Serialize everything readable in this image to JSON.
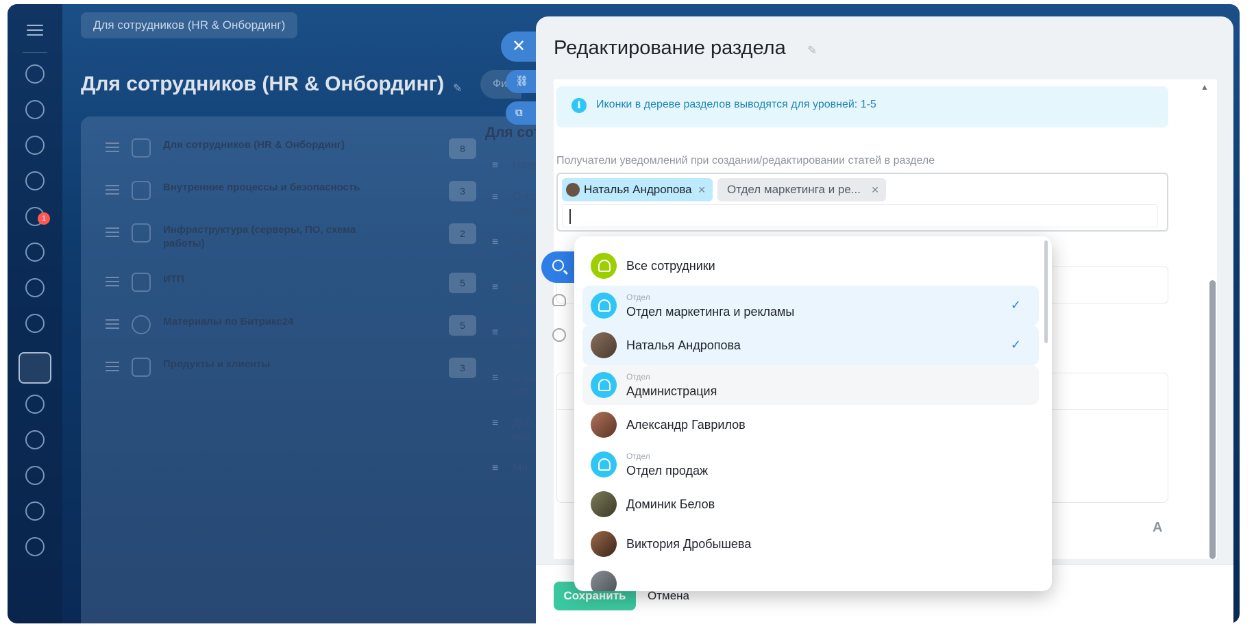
{
  "breadcrumb": "Для сотрудников (HR & Онбординг)",
  "page_title": "Для сотрудников (HR & Онбординг)",
  "filter_label": "Фи",
  "rail": {
    "badge": "1"
  },
  "tree": [
    {
      "label": "Для сотрудников (HR & Онбординг)",
      "count": "8"
    },
    {
      "label": "Внутренние процессы и безопасность",
      "count": "3"
    },
    {
      "label": "Инфраструктура (серверы, ПО, схема работы)",
      "count": "2"
    },
    {
      "label": "ИТП",
      "count": "5"
    },
    {
      "label": "Материалы по Битрикс24",
      "count": "5"
    },
    {
      "label": "Продукты и клиенты",
      "count": "3"
    }
  ],
  "column2": {
    "header": "Для сот",
    "items": [
      "Назв",
      "О ко цен",
      "Шаб спра",
      "Кор спор",
      "Как в си",
      "Стру кто",
      "Доб пер",
      "Мо"
    ]
  },
  "slider": {
    "title": "Редактирование раздела",
    "info": "Иконки в дереве разделов выводятся для уровней: 1-5",
    "recipients_label": "Получатели уведомлений при создании/редактировании статей в разделе",
    "tags": [
      {
        "label": "Наталья Андропова"
      },
      {
        "label": "Отдел маркетинга и ре..."
      }
    ],
    "ghost_letter": "A",
    "save": "Сохранить",
    "cancel": "Отмена"
  },
  "dropdown": {
    "items": [
      {
        "name": "Все сотрудники",
        "sub": "",
        "kind": "group",
        "selected": false
      },
      {
        "name": "Отдел маркетинга и рекламы",
        "sub": "Отдел",
        "kind": "dept",
        "selected": true
      },
      {
        "name": "Наталья Андропова",
        "sub": "",
        "kind": "user",
        "selected": true
      },
      {
        "name": "Администрация",
        "sub": "Отдел",
        "kind": "dept",
        "selected": false
      },
      {
        "name": "Александр Гаврилов",
        "sub": "",
        "kind": "user",
        "selected": false
      },
      {
        "name": "Отдел продаж",
        "sub": "Отдел",
        "kind": "dept",
        "selected": false
      },
      {
        "name": "Доминик Белов",
        "sub": "",
        "kind": "user",
        "selected": false
      },
      {
        "name": "Виктория Дробышева",
        "sub": "",
        "kind": "user",
        "selected": false
      }
    ],
    "check_mark": "✓"
  },
  "colors": {
    "accent": "#2f7ee8",
    "save": "#3bc8a0",
    "info_bg": "#e6f6fd",
    "tag_user": "#bdeafe"
  }
}
